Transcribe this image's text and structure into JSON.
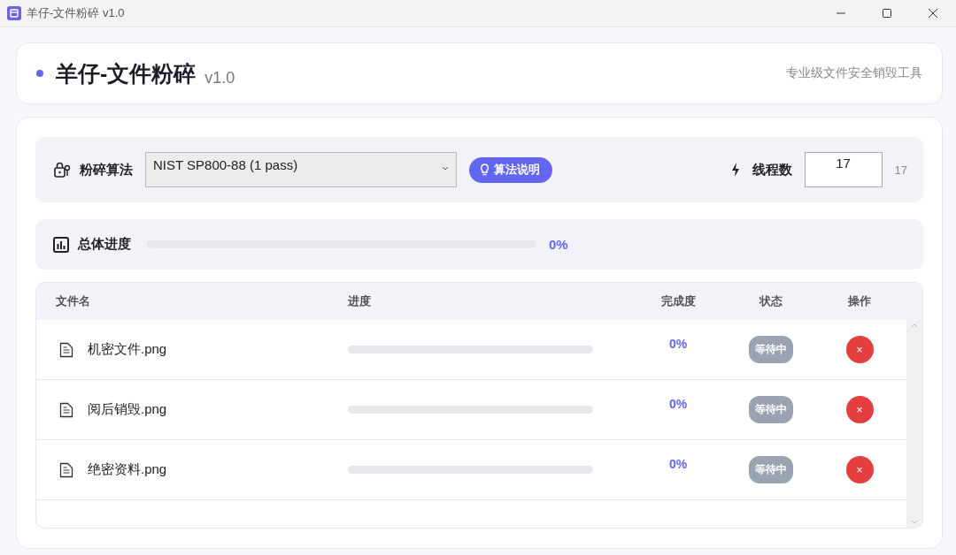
{
  "window": {
    "title": "羊仔-文件粉碎 v1.0"
  },
  "header": {
    "title": "羊仔-文件粉碎",
    "version": "v1.0",
    "subtitle": "专业级文件安全销毁工具"
  },
  "settings": {
    "algorithm_label": "粉碎算法",
    "algorithm_value": "NIST SP800-88 (1 pass)",
    "info_button": "算法说明",
    "threads_label": "线程数",
    "threads_value": "17",
    "threads_reading": "17"
  },
  "overall": {
    "label": "总体进度",
    "level": 0,
    "reading": "0%"
  },
  "table": {
    "columns": [
      "文件名",
      "进度",
      "完成度",
      "状态",
      "操作"
    ],
    "rows": [
      {
        "name": "机密文件.png",
        "level": 0,
        "percent": "0%",
        "status": "等待中",
        "action": "×"
      },
      {
        "name": "阅后销毁.png",
        "level": 0,
        "percent": "0%",
        "status": "等待中",
        "action": "×"
      },
      {
        "name": "绝密资料.png",
        "level": 0,
        "percent": "0%",
        "status": "等待中",
        "action": "×"
      }
    ]
  }
}
